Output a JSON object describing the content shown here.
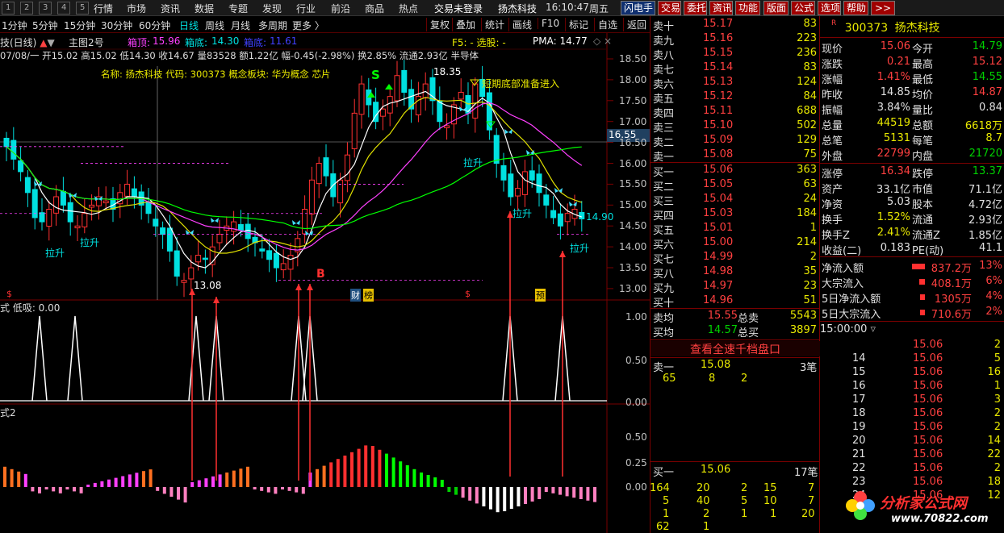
{
  "menubar": {
    "left_buttons": [
      "1",
      "2",
      "3",
      "4",
      "5"
    ],
    "items": [
      "行情",
      "市场",
      "资讯",
      "数据",
      "专题",
      "发现",
      "行业",
      "前沿",
      "商品",
      "热点"
    ],
    "login": "交易未登录",
    "stock_name": "扬杰科技",
    "time": "16:10:47",
    "weekday": "周五",
    "tool_buttons": [
      "闪电手",
      "交易",
      "委托",
      "资讯",
      "功能",
      "版面",
      "公式",
      "选项",
      "帮助",
      ">>"
    ]
  },
  "periods": [
    "1分钟",
    "5分钟",
    "15分钟",
    "30分钟",
    "60分钟",
    "日线",
    "周线",
    "月线",
    "多周期",
    "更多 〉"
  ],
  "active_period": "日线",
  "right_tools": [
    "复权",
    "叠加",
    "统计",
    "画线",
    "F10",
    "标记",
    "自选",
    "返回"
  ],
  "chart_header": {
    "name": "技(日线)",
    "indicator": "主图2号",
    "box_top_label": "箱顶:",
    "box_top": "15.96",
    "box_bottom_label": "箱底:",
    "box_bottom": "14.30",
    "dk_label": "箱底:",
    "dk_value": "11.61",
    "f5": "F5: - 选股: -",
    "pma": "PMA: 14.77",
    "ohlc_line": "07/08/一 开15.02 高15.02 低14.30 收14.67 量83528 额1.22亿 幅-0.45(-2.98%) 换2.85% 流通2.93亿 半导体",
    "info_line": "名称: 扬杰科技 代码: 300373 概念板块: 华为概念 芯片"
  },
  "price_axis": [
    "18.50",
    "18.00",
    "17.50",
    "17.00",
    "16.50",
    "16.00",
    "15.50",
    "15.00",
    "14.50",
    "14.00",
    "13.50",
    "13.00"
  ],
  "current_price_tag": "16.55",
  "last_price_tag": "14.90",
  "annotations": {
    "high": "18.35",
    "low": "13.08",
    "signal_text": "短期底部准备进入",
    "lift1": "拉升",
    "lift2": "拉升",
    "lift3": "拉升",
    "lift4": "拉升",
    "lift5": "拉升",
    "buy": "B",
    "sell_s": "S",
    "tag_cai": "财",
    "tag_bang": "榜",
    "tag_yu": "预",
    "dollar1": "$",
    "dollar2": "$"
  },
  "sub1": {
    "title": "式  低吸: 0.00",
    "axis": [
      "1.00",
      "0.50",
      "0.00"
    ]
  },
  "sub2": {
    "title": "式2",
    "axis": [
      "0.50",
      "0.25",
      "0.00"
    ]
  },
  "order_book": {
    "asks": [
      {
        "label": "卖十",
        "price": "15.17",
        "vol": "83"
      },
      {
        "label": "卖九",
        "price": "15.16",
        "vol": "223"
      },
      {
        "label": "卖八",
        "price": "15.15",
        "vol": "236"
      },
      {
        "label": "卖七",
        "price": "15.14",
        "vol": "83"
      },
      {
        "label": "卖六",
        "price": "15.13",
        "vol": "124"
      },
      {
        "label": "卖五",
        "price": "15.12",
        "vol": "84"
      },
      {
        "label": "卖四",
        "price": "15.11",
        "vol": "688"
      },
      {
        "label": "卖三",
        "price": "15.10",
        "vol": "502"
      },
      {
        "label": "卖二",
        "price": "15.09",
        "vol": "129"
      },
      {
        "label": "卖一",
        "price": "15.08",
        "vol": "75"
      }
    ],
    "bids": [
      {
        "label": "买一",
        "price": "15.06",
        "vol": "363"
      },
      {
        "label": "买二",
        "price": "15.05",
        "vol": "63"
      },
      {
        "label": "买三",
        "price": "15.04",
        "vol": "24"
      },
      {
        "label": "买四",
        "price": "15.03",
        "vol": "184"
      },
      {
        "label": "买五",
        "price": "15.01",
        "vol": "1"
      },
      {
        "label": "买六",
        "price": "15.00",
        "vol": "214"
      },
      {
        "label": "买七",
        "price": "14.99",
        "vol": "2"
      },
      {
        "label": "买八",
        "price": "14.98",
        "vol": "35"
      },
      {
        "label": "买九",
        "price": "14.97",
        "vol": "23"
      },
      {
        "label": "买十",
        "price": "14.96",
        "vol": "51"
      }
    ],
    "avg_sell_label": "卖均",
    "avg_sell": "15.55",
    "total_sell_label": "总卖",
    "total_sell": "5543",
    "avg_buy_label": "买均",
    "avg_buy": "14.57",
    "total_buy_label": "总买",
    "total_buy": "3897",
    "view_full": "查看全速千档盘口",
    "ask1_label": "卖一",
    "ask1_price": "15.08",
    "ask1_count": "3笔",
    "ask1_orders": [
      "65",
      "8",
      "2"
    ],
    "bid1_label": "买一",
    "bid1_price": "15.06",
    "bid1_count": "17笔",
    "bid1_orders": [
      [
        "164",
        "20",
        "2",
        "15",
        "7"
      ],
      [
        "5",
        "40",
        "5",
        "10",
        "7"
      ],
      [
        "1",
        "2",
        "1",
        "1",
        "20"
      ],
      [
        "62",
        "1",
        "",
        "",
        ""
      ]
    ]
  },
  "quote": {
    "code": "300373",
    "name": "扬杰科技",
    "rows": [
      [
        "现价",
        "15.06",
        "今开",
        "14.79"
      ],
      [
        "涨跌",
        "0.21",
        "最高",
        "15.12"
      ],
      [
        "涨幅",
        "1.41%",
        "最低",
        "14.55"
      ],
      [
        "昨收",
        "14.85",
        "均价",
        "14.87"
      ],
      [
        "振幅",
        "3.84%",
        "量比",
        "0.84"
      ],
      [
        "总量",
        "44519",
        "总额",
        "6618万"
      ],
      [
        "总笔",
        "5131",
        "每笔",
        "8.7"
      ],
      [
        "外盘",
        "22799",
        "内盘",
        "21720"
      ]
    ],
    "rows2": [
      [
        "涨停",
        "16.34",
        "跌停",
        "13.37"
      ],
      [
        "资产",
        "33.1亿",
        "市值",
        "71.1亿"
      ],
      [
        "净资",
        "5.03",
        "股本",
        "4.72亿"
      ],
      [
        "换手",
        "1.52%",
        "流通",
        "2.93亿"
      ],
      [
        "换手Z",
        "2.41%",
        "流通Z",
        "1.85亿"
      ],
      [
        "收益(二)",
        "0.183",
        "PE(动)",
        "41.1"
      ]
    ],
    "flows": [
      {
        "label": "净流入额",
        "value": "837.2万",
        "pct": "13%",
        "level": 0.13
      },
      {
        "label": "大宗流入",
        "value": "408.1万",
        "pct": "6%",
        "level": 0.06
      },
      {
        "label": "5日净流入额",
        "value": "1305万",
        "pct": "4%",
        "level": 0.04
      },
      {
        "label": "5日大宗流入",
        "value": "710.6万",
        "pct": "2%",
        "level": 0.02
      }
    ]
  },
  "ticks": {
    "header": "15:00:00",
    "rows": [
      [
        "",
        "15.06",
        "2"
      ],
      [
        "14",
        "15.06",
        "5"
      ],
      [
        "15",
        "15.06",
        "16"
      ],
      [
        "16",
        "15.06",
        "1"
      ],
      [
        "17",
        "15.06",
        "3"
      ],
      [
        "18",
        "15.06",
        "2"
      ],
      [
        "19",
        "15.06",
        "2"
      ],
      [
        "20",
        "15.06",
        "14"
      ],
      [
        "21",
        "15.06",
        "22"
      ],
      [
        "22",
        "15.06",
        "2"
      ],
      [
        "23",
        "15.06",
        "18"
      ],
      [
        "24",
        "15.06",
        "12"
      ]
    ]
  },
  "watermark": {
    "name": "分析家公式网",
    "url": "www.70822.com"
  },
  "colors": {
    "up": "#ff3030",
    "down": "#00e0e0",
    "ma5": "#ffffff",
    "ma10": "#e0e000",
    "ma20": "#ff40ff",
    "ma60": "#00ff00",
    "grid": "#7a0000"
  }
}
